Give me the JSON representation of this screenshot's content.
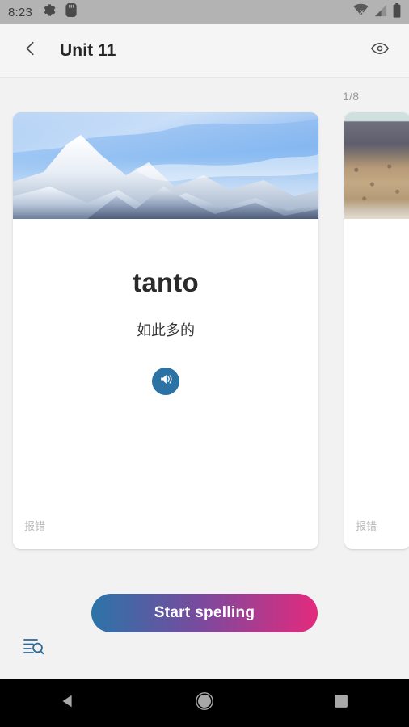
{
  "status_bar": {
    "time": "8:23",
    "icons": [
      "gear-icon",
      "sd-card-icon",
      "wifi-off-icon",
      "cellular-signal-icon",
      "battery-icon"
    ],
    "background": "#b3b3b3"
  },
  "app_bar": {
    "back_icon": "chevron-left-icon",
    "title": "Unit 11",
    "action_icon": "eye-icon"
  },
  "content": {
    "counter": "1/8",
    "cards": [
      {
        "image": "snowy-mountain-photo",
        "word": "tanto",
        "translation": "如此多的",
        "audio_icon": "speaker-icon",
        "report_label": "报错"
      },
      {
        "image": "desert-mountain-photo",
        "report_label": "报错"
      }
    ]
  },
  "actions": {
    "start_spelling_label": "Start spelling",
    "list_search_icon": "list-search-icon"
  },
  "nav_bar": {
    "back_icon": "nav-back-triangle-icon",
    "home_icon": "nav-home-circle-icon",
    "recents_icon": "nav-recents-square-icon"
  },
  "colors": {
    "accent_blue": "#2b73a4",
    "gradient_start": "#2b74a8",
    "gradient_end": "#e32a7d",
    "page_background": "#f2f2f2",
    "app_bar_background": "#f5f5f5",
    "nav_background": "#000000"
  }
}
